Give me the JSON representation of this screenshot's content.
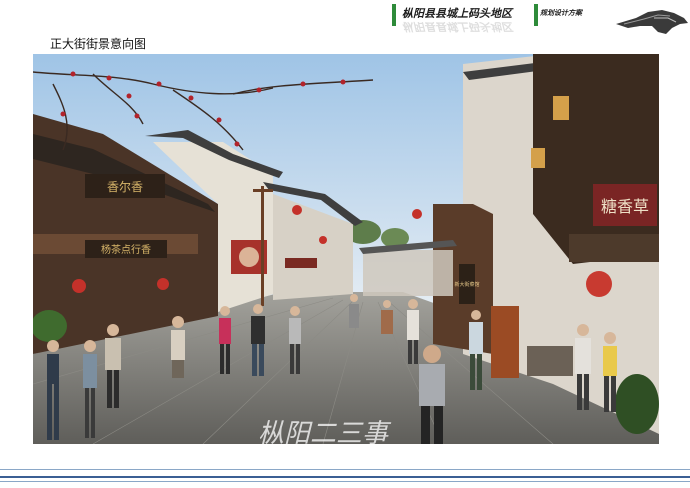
{
  "header": {
    "title": "枞阳县县城上码头地区",
    "subtitle": "规划设计方案"
  },
  "page_title": "正大街街景意向图",
  "scene": {
    "sign_left_top": "香尔香",
    "sign_left_bottom": "杨茶点行香",
    "sign_right": "糖香草",
    "sign_small": "新大街菜馆",
    "watermark": "枞阳二三事"
  },
  "colors": {
    "accent_green": "#2e8b3a",
    "footer_blue": "#3b5f94"
  }
}
